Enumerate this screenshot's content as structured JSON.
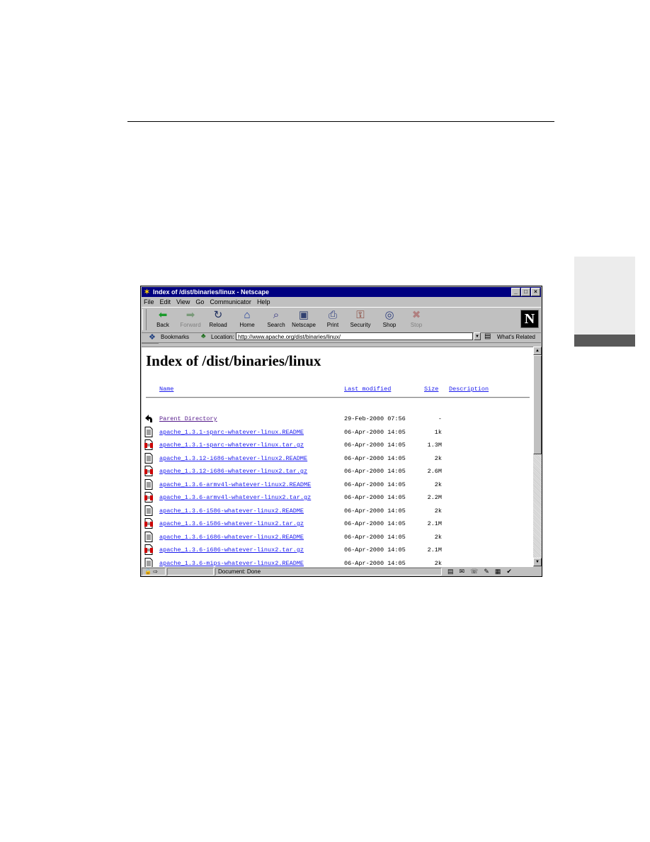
{
  "window": {
    "title": "Index of /dist/binaries/linux - Netscape",
    "controls": [
      "_",
      "□",
      "×"
    ]
  },
  "menu": [
    "File",
    "Edit",
    "View",
    "Go",
    "Communicator",
    "Help"
  ],
  "toolbar": [
    {
      "label": "Back",
      "icon": "back-arrow-icon",
      "glyph": "⬅",
      "color": "#1a9a2a",
      "disabled": false
    },
    {
      "label": "Forward",
      "icon": "forward-arrow-icon",
      "glyph": "➡",
      "color": "#7a9a7a",
      "disabled": true
    },
    {
      "label": "Reload",
      "icon": "reload-icon",
      "glyph": "↻",
      "color": "#203060",
      "disabled": false
    },
    {
      "label": "Home",
      "icon": "home-icon",
      "glyph": "⌂",
      "color": "#1a3a9a",
      "disabled": false
    },
    {
      "label": "Search",
      "icon": "search-icon",
      "glyph": "⌕",
      "color": "#303080",
      "disabled": false
    },
    {
      "label": "Netscape",
      "icon": "netscape-icon",
      "glyph": "▣",
      "color": "#304070",
      "disabled": false
    },
    {
      "label": "Print",
      "icon": "print-icon",
      "glyph": "⎙",
      "color": "#304080",
      "disabled": false
    },
    {
      "label": "Security",
      "icon": "lock-icon",
      "glyph": "⚿",
      "color": "#803020",
      "disabled": false
    },
    {
      "label": "Shop",
      "icon": "shop-icon",
      "glyph": "◎",
      "color": "#304080",
      "disabled": false
    },
    {
      "label": "Stop",
      "icon": "stop-icon",
      "glyph": "✖",
      "color": "#b08080",
      "disabled": true
    }
  ],
  "location": {
    "bookmarks_label": "Bookmarks",
    "location_label": "Location:",
    "url": "http://www.apache.org/dist/binaries/linux/",
    "whats_related": "What's Related"
  },
  "page": {
    "heading": "Index of /dist/binaries/linux",
    "columns": {
      "name": "Name",
      "modified": "Last modified",
      "size": "Size",
      "description": "Description"
    },
    "rows": [
      {
        "name": "Parent Directory",
        "date": "29-Feb-2000 07:56",
        "size": "-",
        "type": "parent"
      },
      {
        "name": "apache_1.3.1-sparc-whatever-linux.README",
        "date": "06-Apr-2000 14:05",
        "size": "1k",
        "type": "text"
      },
      {
        "name": "apache_1.3.1-sparc-whatever-linux.tar.gz",
        "date": "06-Apr-2000 14:05",
        "size": "1.3M",
        "type": "archive"
      },
      {
        "name": "apache_1.3.12-i686-whatever-linux2.README",
        "date": "06-Apr-2000 14:05",
        "size": "2k",
        "type": "text"
      },
      {
        "name": "apache_1.3.12-i686-whatever-linux2.tar.gz",
        "date": "06-Apr-2000 14:05",
        "size": "2.6M",
        "type": "archive"
      },
      {
        "name": "apache_1.3.6-armv4l-whatever-linux2.README",
        "date": "06-Apr-2000 14:05",
        "size": "2k",
        "type": "text"
      },
      {
        "name": "apache_1.3.6-armv4l-whatever-linux2.tar.gz",
        "date": "06-Apr-2000 14:05",
        "size": "2.2M",
        "type": "archive"
      },
      {
        "name": "apache_1.3.6-i586-whatever-linux2.README",
        "date": "06-Apr-2000 14:05",
        "size": "2k",
        "type": "text"
      },
      {
        "name": "apache_1.3.6-i586-whatever-linux2.tar.gz",
        "date": "06-Apr-2000 14:05",
        "size": "2.1M",
        "type": "archive"
      },
      {
        "name": "apache_1.3.6-i686-whatever-linux2.README",
        "date": "06-Apr-2000 14:05",
        "size": "2k",
        "type": "text"
      },
      {
        "name": "apache_1.3.6-i686-whatever-linux2.tar.gz",
        "date": "06-Apr-2000 14:05",
        "size": "2.1M",
        "type": "archive"
      },
      {
        "name": "apache_1.3.6-mips-whatever-linux2.README",
        "date": "06-Apr-2000 14:05",
        "size": "2k",
        "type": "text"
      }
    ]
  },
  "status": {
    "text": "Document: Done"
  }
}
